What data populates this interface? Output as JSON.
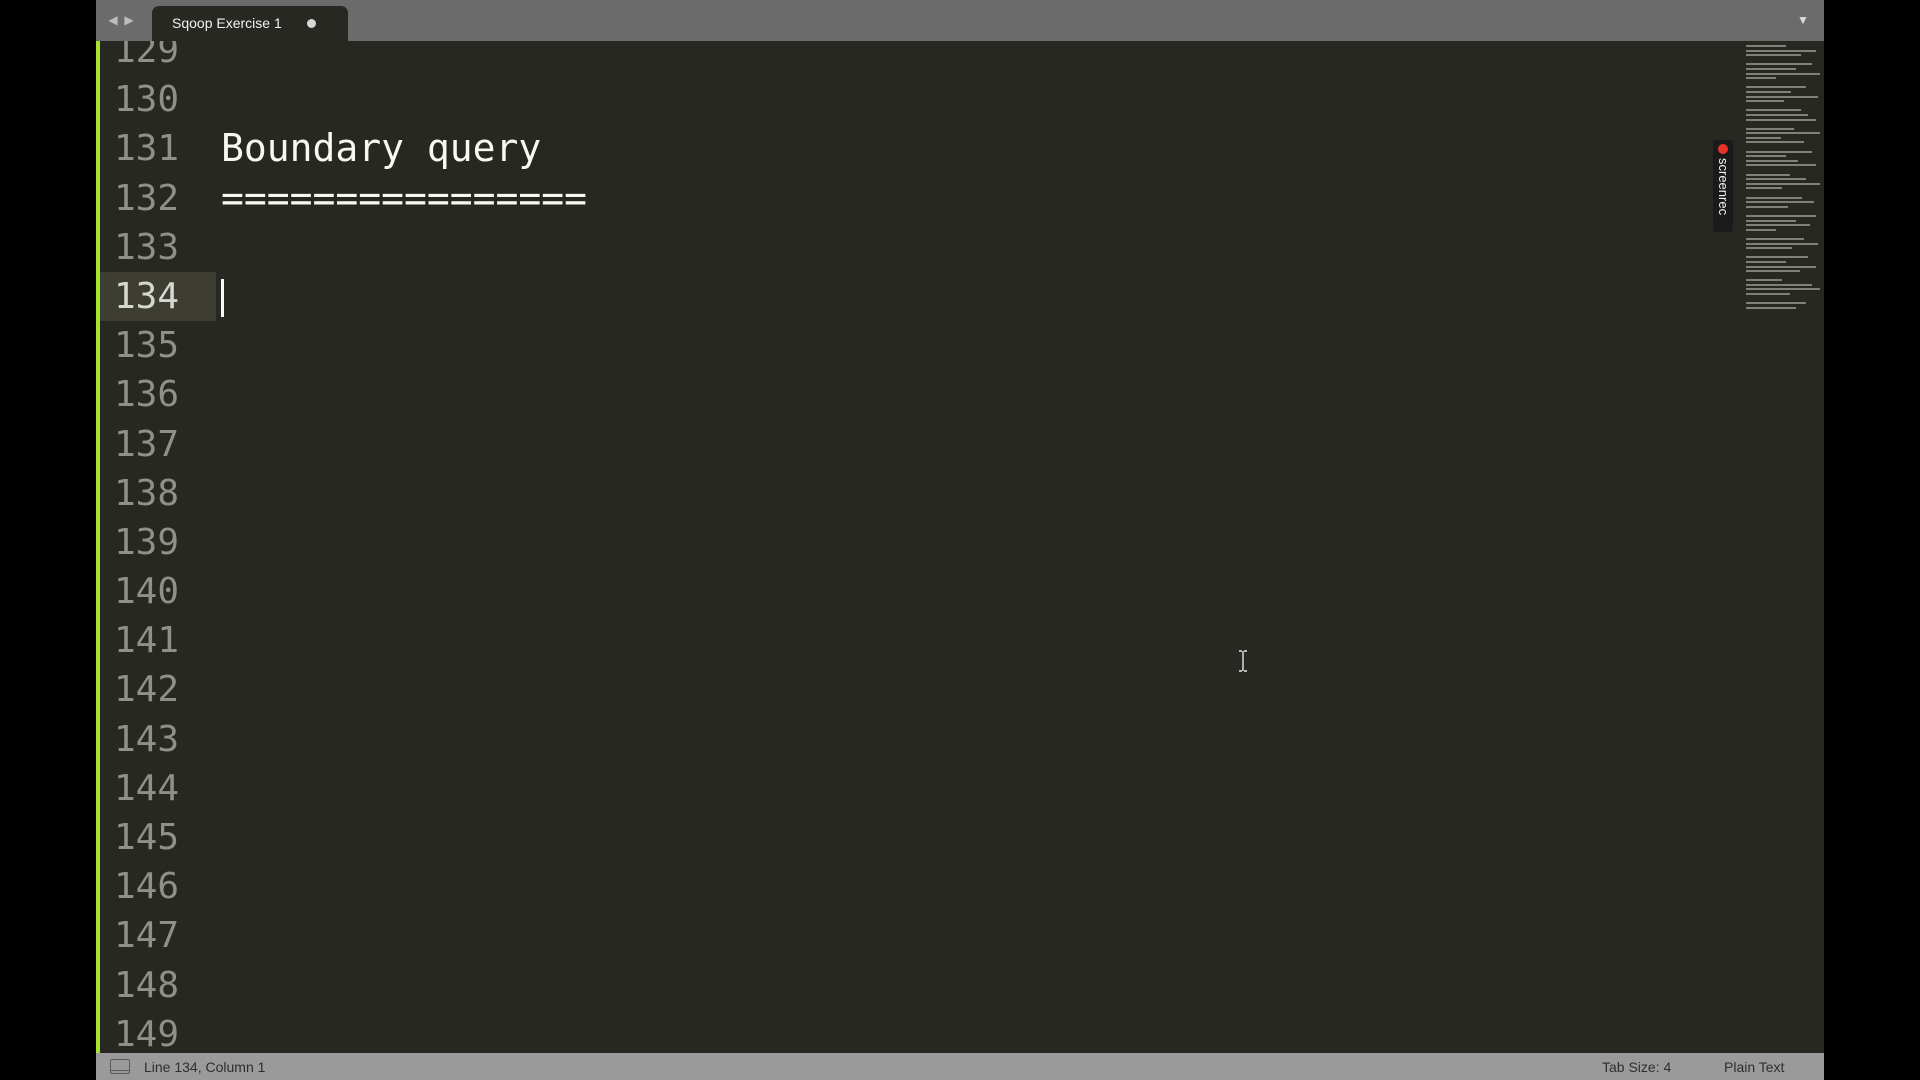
{
  "tab": {
    "title": "Sqoop Exercise 1",
    "dirty": true
  },
  "editor": {
    "active_line": "134",
    "line_numbers": [
      "129",
      "130",
      "131",
      "132",
      "133",
      "134",
      "135",
      "136",
      "137",
      "138",
      "139",
      "140",
      "141",
      "142",
      "143",
      "144",
      "145",
      "146",
      "147",
      "148",
      "149"
    ],
    "lines": [
      "",
      "",
      "Boundary query",
      "================",
      "",
      "",
      "",
      "",
      "",
      "",
      "",
      "",
      "",
      "",
      "",
      "",
      "",
      "",
      "",
      "",
      ""
    ]
  },
  "recorder": {
    "label": "screenrec"
  },
  "status": {
    "position": "Line 134, Column 1",
    "tab_size": "Tab Size: 4",
    "syntax": "Plain Text"
  },
  "icons": {
    "nav_back": "triangle-left-icon",
    "nav_forward": "triangle-right-icon",
    "overflow": "triangle-down-icon",
    "panel": "panel-toggle-icon",
    "cursor": "text-cursor-icon"
  },
  "colors": {
    "editor_bg": "#272822",
    "tabbar_bg": "#6b6b6b",
    "statusbar_bg": "#9a9a9a",
    "accent": "#a6e22e",
    "active_line_bg": "#3e3d32",
    "record_red": "#e8332a"
  }
}
